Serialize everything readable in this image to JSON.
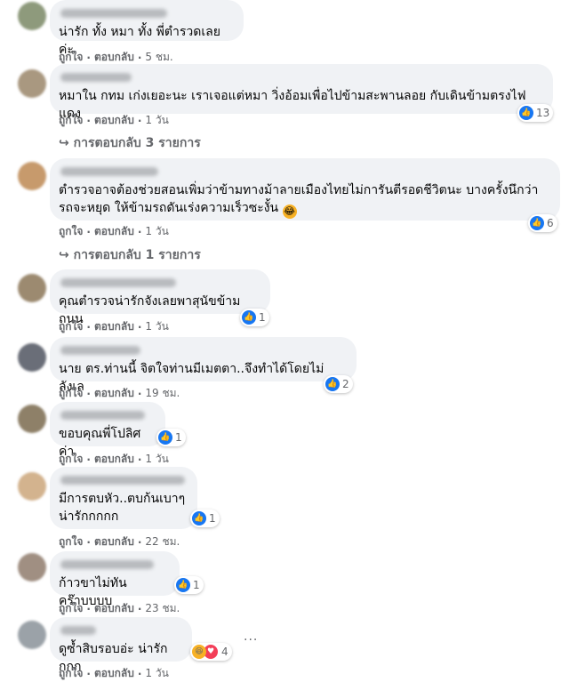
{
  "actions": {
    "like": "ถูกใจ",
    "reply": "ตอบกลับ",
    "dot": "·"
  },
  "comments": [
    {
      "text": "น่ารัก ทั้ง หมา ทั้ง พี่ตำรวดเลยค่ะ",
      "time": "5 ชม."
    },
    {
      "text": "หมาใน กทม เก่งเยอะนะ เราเจอแต่หมา วิ่งอ้อมเพื่อไปข้ามสะพานลอย กับเดินข้ามตรงไฟแดง",
      "time": "1 วัน",
      "reactions": "13",
      "replies": "↪ การตอบกลับ 3 รายการ"
    },
    {
      "text": "ตำรวจอาจต้องช่วยสอนเพิ่มว่าข้ามทางม้าลายเมืองไทยไม่การันตีรอดชีวิตนะ บางครั้งนึกว่ารถจะหยุด ให้ข้ามรถดันเร่งความเร็วซะงั้น",
      "emoji": "😂",
      "time": "1 วัน",
      "reactions": "6",
      "replies": "↪ การตอบกลับ 1 รายการ"
    },
    {
      "text": "คุณตำรวจน่ารักจังเลยพาสุนัขข้ามถนน",
      "time": "1 วัน",
      "reactions": "1"
    },
    {
      "text": "นาย ตร.ท่านนี้ จิตใจท่านมีเมตตา..จึงทำได้โดยไม่ลังเล",
      "time": "19 ชม.",
      "reactions": "2"
    },
    {
      "text": "ขอบคุณพี่โปลิศค่า",
      "time": "1 วัน",
      "reactions": "1"
    },
    {
      "text": "มีการตบหัว..ตบก้นเบาๆ\nน่ารักกกกก",
      "time": "22 ชม.",
      "reactions": "1"
    },
    {
      "text": "ก้าวขาไม่ทันคร๊าบบบบ",
      "time": "23 ชม.",
      "reactions": "1"
    },
    {
      "text": "ดูซ้ำสิบรอบอ่ะ น่ารักกกก",
      "time": "1 วัน",
      "reactions": "4"
    }
  ],
  "more_menu": "···"
}
